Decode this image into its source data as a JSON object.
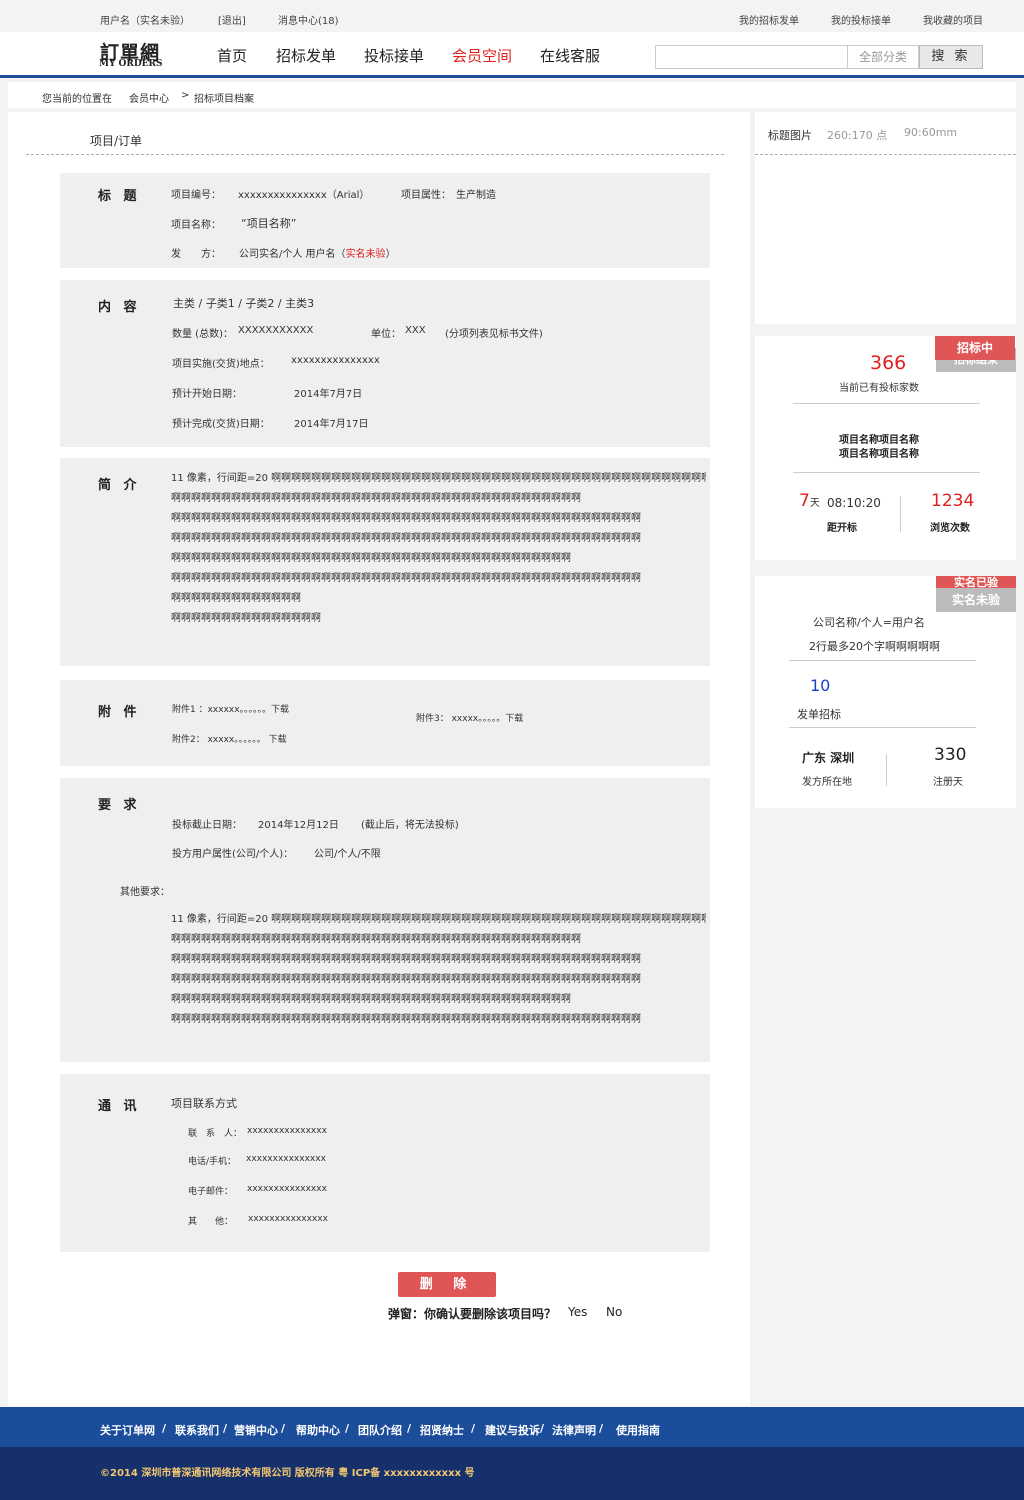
{
  "topbar": {
    "username": "用户名（实名未验）",
    "logout": "[退出]",
    "messages": "消息中心(18)",
    "my_posts": "我的招标发单",
    "my_bids": "我的投标接单",
    "my_favorites": "我收藏的项目"
  },
  "logo": {
    "cn": "訂單網",
    "en": "MY ORDERS"
  },
  "nav": [
    "首页",
    "招标发单",
    "投标接单",
    "会员空间",
    "在线客服"
  ],
  "search": {
    "category": "全部分类",
    "button": "搜 索"
  },
  "breadcrumb": {
    "prefix": "您当前的位置在",
    "level1": "会员中心",
    "sep": ">",
    "level2": "招标项目档案"
  },
  "page_title": "项目/订单",
  "sections": {
    "title": {
      "label": "标 题",
      "project_no_label": "项目编号：",
      "project_no_value": "xxxxxxxxxxxxxxx（Arial）",
      "attr_label": "项目属性：",
      "attr_value": "生产制造",
      "name_label": "项目名称：",
      "name_value": "“项目名称”",
      "issuer_label": "发　　方：",
      "issuer_value": "公司实名/个人 用户名（",
      "issuer_status": "实名未验",
      "issuer_close": "）"
    },
    "content": {
      "label": "内 容",
      "category": "主类 / 子类1 / 子类2 / 主类3",
      "qty_label": "数量 (总数)：",
      "qty_value": "XXXXXXXXXXX",
      "unit_label": "单位：",
      "unit_value": "XXX",
      "unit_note": "(分项列表见标书文件)",
      "location_label": "项目实施(交货)地点：",
      "location_value": "xxxxxxxxxxxxxxx",
      "start_label": "预计开始日期：",
      "start_value": "2014年7月7日",
      "end_label": "预计完成(交货)日期：",
      "end_value": "2014年7月17日"
    },
    "intro": {
      "label": "简 介",
      "lines": [
        "11 像素，行间距=20 啊啊啊啊啊啊啊啊啊啊啊啊啊啊啊啊啊啊啊啊啊啊啊啊啊啊啊啊啊啊啊啊啊啊啊啊啊啊啊啊啊啊啊啊啊啊啊啊。",
        "啊啊啊啊啊啊啊啊啊啊啊啊啊啊啊啊啊啊啊啊啊啊啊啊啊啊啊啊啊啊啊啊啊啊啊啊啊啊啊啊啊",
        "啊啊啊啊啊啊啊啊啊啊啊啊啊啊啊啊啊啊啊啊啊啊啊啊啊啊啊啊啊啊啊啊啊啊啊啊啊啊啊啊啊啊啊啊啊啊啊",
        "啊啊啊啊啊啊啊啊啊啊啊啊啊啊啊啊啊啊啊啊啊啊啊啊啊啊啊啊啊啊啊啊啊啊啊啊啊啊啊啊啊啊啊啊啊啊啊",
        "啊啊啊啊啊啊啊啊啊啊啊啊啊啊啊啊啊啊啊啊啊啊啊啊啊啊啊啊啊啊啊啊啊啊啊啊啊啊啊啊",
        "啊啊啊啊啊啊啊啊啊啊啊啊啊啊啊啊啊啊啊啊啊啊啊啊啊啊啊啊啊啊啊啊啊啊啊啊啊啊啊啊啊啊啊啊啊啊啊",
        "啊啊啊啊啊啊啊啊啊啊啊啊啊",
        "啊啊啊啊啊啊啊啊啊啊啊啊啊啊啊"
      ]
    },
    "attachments": {
      "label": "附 件",
      "a1": "附件1 ：xxxxxx。。。。。。下载",
      "a2": "附件2： xxxxx。。。。。。 下载",
      "a3": "附件3： xxxxx。。。。。下载"
    },
    "requirements": {
      "label": "要 求",
      "deadline_label": "投标截止日期：",
      "deadline_value": "2014年12月12日",
      "deadline_note": "(截止后，将无法投标)",
      "user_attr_label": "投方用户属性(公司/个人)：",
      "user_attr_value": "公司/个人/不限",
      "other_label": "其他要求：",
      "lines": [
        "11 像素，行间距=20 啊啊啊啊啊啊啊啊啊啊啊啊啊啊啊啊啊啊啊啊啊啊啊啊啊啊啊啊啊啊啊啊啊啊啊啊啊啊啊啊啊啊啊啊啊啊啊啊。",
        "啊啊啊啊啊啊啊啊啊啊啊啊啊啊啊啊啊啊啊啊啊啊啊啊啊啊啊啊啊啊啊啊啊啊啊啊啊啊啊啊啊",
        "啊啊啊啊啊啊啊啊啊啊啊啊啊啊啊啊啊啊啊啊啊啊啊啊啊啊啊啊啊啊啊啊啊啊啊啊啊啊啊啊啊啊啊啊啊啊啊",
        "啊啊啊啊啊啊啊啊啊啊啊啊啊啊啊啊啊啊啊啊啊啊啊啊啊啊啊啊啊啊啊啊啊啊啊啊啊啊啊啊啊啊啊啊啊啊啊",
        "啊啊啊啊啊啊啊啊啊啊啊啊啊啊啊啊啊啊啊啊啊啊啊啊啊啊啊啊啊啊啊啊啊啊啊啊啊啊啊啊",
        "啊啊啊啊啊啊啊啊啊啊啊啊啊啊啊啊啊啊啊啊啊啊啊啊啊啊啊啊啊啊啊啊啊啊啊啊啊啊啊啊啊啊啊啊啊啊啊"
      ]
    },
    "contact": {
      "label": "通 讯",
      "heading": "项目联系方式",
      "person_label": "联　系　人：",
      "person_value": "xxxxxxxxxxxxxxx",
      "phone_label": "电话/手机：",
      "phone_value": "xxxxxxxxxxxxxxx",
      "email_label": "电子邮件：",
      "email_value": "xxxxxxxxxxxxxxx",
      "other_label": "其　　他：",
      "other_value": "xxxxxxxxxxxxxxx"
    }
  },
  "actions": {
    "delete": "删 除",
    "confirm_text": "弹窗：你确认要删除该项目吗？",
    "yes": "Yes",
    "no": "No"
  },
  "sidebar": {
    "image_label": "标题图片",
    "image_size1": "260:170 点",
    "image_size2": "90:60mm",
    "status_badge": "招标中",
    "status_badge_under": "招标结束",
    "bidders_count": "366",
    "bidders_label": "当前已有投标家数",
    "project_name_1": "项目名称项目名称",
    "project_name_2": "项目名称项目名称",
    "days": "7",
    "days_unit": "天",
    "countdown": "08:10:20",
    "countdown_label": "距开标",
    "views": "1234",
    "views_label": "浏览次数",
    "verify_badge": "实名未验",
    "verify_badge_under": "实名已验",
    "company": "公司名称/个人=用户名",
    "company_note": "2行最多20个字啊啊啊啊啊",
    "posts_count": "10",
    "posts_label": "发单招标",
    "region": "广东 深圳",
    "region_label": "发方所在地",
    "reg_days": "330",
    "reg_days_label": "注册天"
  },
  "footer": {
    "links": [
      "关于订单网",
      "/",
      "联系我们",
      "/",
      "营销中心",
      "/",
      "帮助中心",
      "/",
      "团队介绍",
      "/",
      "招贤纳士",
      "/",
      "建议与投诉",
      "/",
      "法律声明",
      "/",
      "使用指南"
    ],
    "copyright": "©2014 深圳市普深通讯网络技术有限公司 版权所有 粤 ICP备 xxxxxxxxxxxx 号"
  },
  "colors": {
    "brand_blue": "#1b4d9b",
    "accent_red": "#e02020",
    "footer_dark": "#16306b"
  }
}
